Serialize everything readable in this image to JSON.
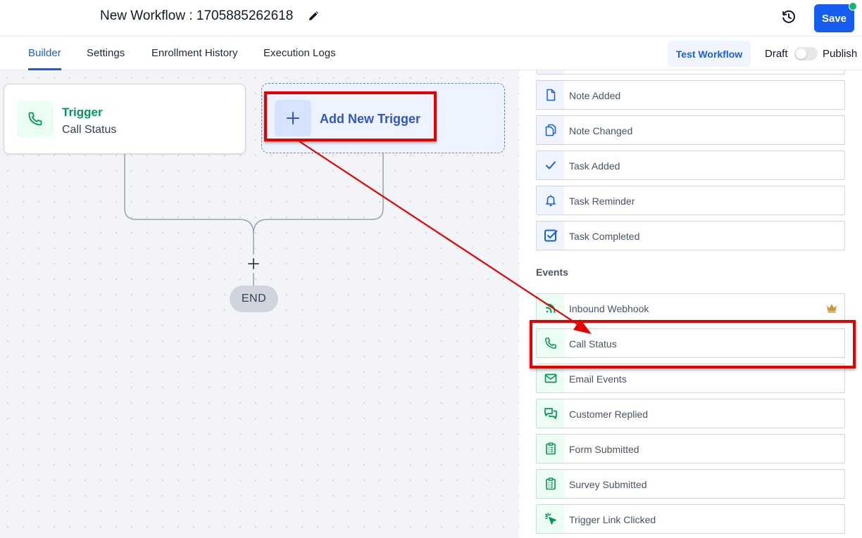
{
  "header": {
    "title": "New Workflow : 1705885262618",
    "save_label": "Save"
  },
  "tabs": [
    {
      "label": "Builder",
      "active": true
    },
    {
      "label": "Settings",
      "active": false
    },
    {
      "label": "Enrollment History",
      "active": false
    },
    {
      "label": "Execution Logs",
      "active": false
    }
  ],
  "toolbar": {
    "test_workflow_label": "Test Workflow",
    "draft_label": "Draft",
    "publish_label": "Publish",
    "published": false
  },
  "canvas": {
    "trigger_card": {
      "title": "Trigger",
      "subtitle": "Call Status"
    },
    "add_trigger_label": "Add New Trigger",
    "end_label": "END"
  },
  "panel": {
    "items_top": [
      {
        "label": "Note Added",
        "icon": "document-icon"
      },
      {
        "label": "Note Changed",
        "icon": "documents-icon"
      },
      {
        "label": "Task Added",
        "icon": "check-icon"
      },
      {
        "label": "Task Reminder",
        "icon": "bell-icon"
      },
      {
        "label": "Task Completed",
        "icon": "checkbox-icon"
      }
    ],
    "events_header": "Events",
    "events": [
      {
        "label": "Inbound Webhook",
        "icon": "rss-icon",
        "premium": true
      },
      {
        "label": "Call Status",
        "icon": "phone-icon"
      },
      {
        "label": "Email Events",
        "icon": "mail-icon"
      },
      {
        "label": "Customer Replied",
        "icon": "chat-icon"
      },
      {
        "label": "Form Submitted",
        "icon": "clipboard-icon"
      },
      {
        "label": "Survey Submitted",
        "icon": "clipboard-icon"
      },
      {
        "label": "Trigger Link Clicked",
        "icon": "cursor-click-icon"
      }
    ]
  },
  "colors": {
    "primary": "#155eef",
    "trigger_green": "#039855",
    "annotation_red": "#e60000",
    "status_dot": "#12b76a"
  }
}
